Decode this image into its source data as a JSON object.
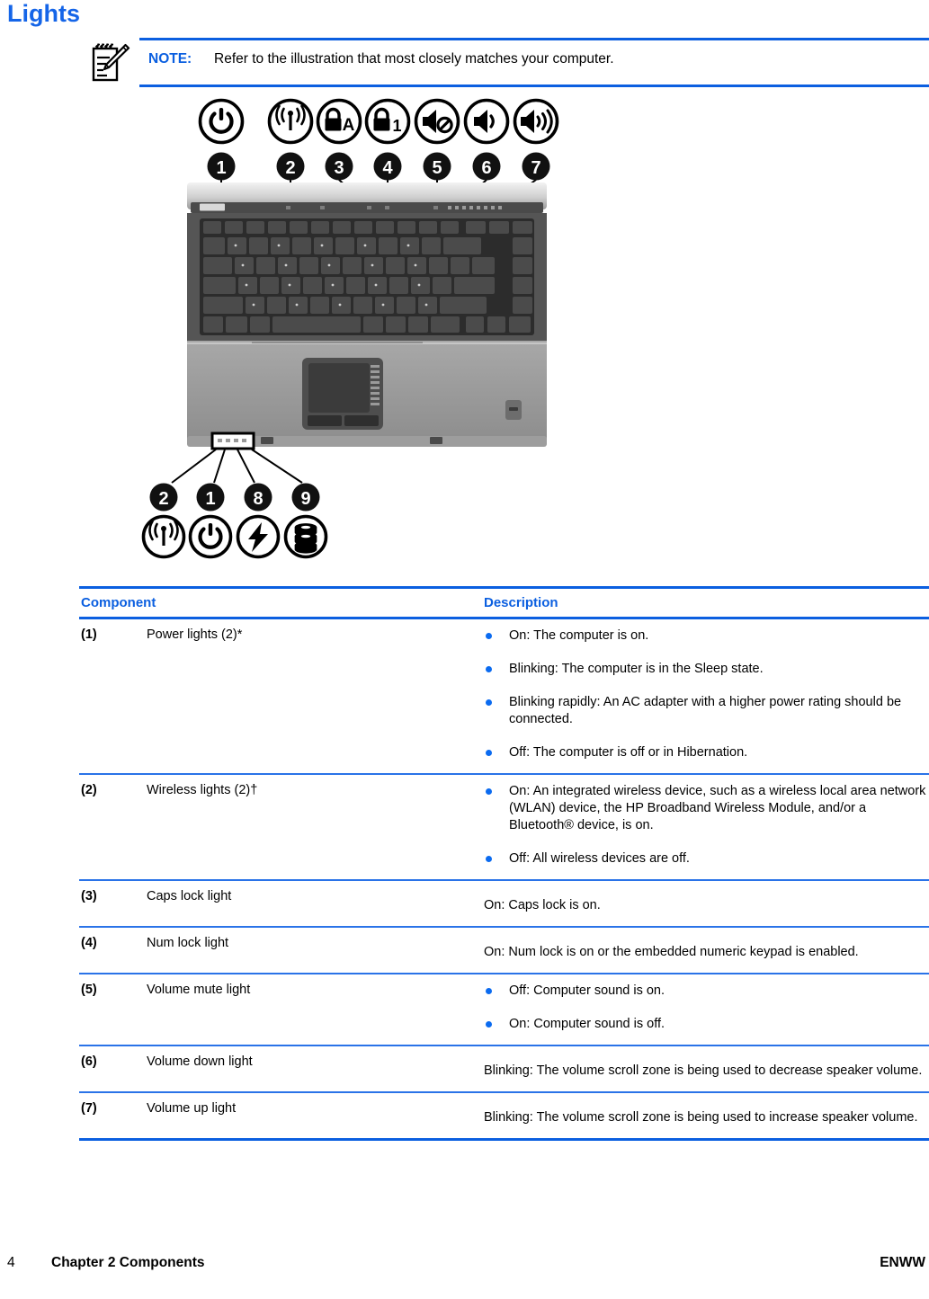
{
  "colors": {
    "accent_blue": "#0B5FE0",
    "title_blue": "#1565E8",
    "bullet_blue": "#0B6BF0"
  },
  "page": {
    "title": "Lights"
  },
  "note": {
    "icon": "note-pencil-icon",
    "label": "NOTE:",
    "text": "Refer to the illustration that most closely matches your computer."
  },
  "figure": {
    "alt": "Line drawing of an HP notebook computer showing the locations of the lights above the keyboard and on the front edge",
    "top_icons": [
      {
        "callout": "1",
        "icon": "power-icon"
      },
      {
        "callout": "2",
        "icon": "wireless-icon"
      },
      {
        "callout": "3",
        "icon": "caps-lock-icon"
      },
      {
        "callout": "4",
        "icon": "num-lock-icon"
      },
      {
        "callout": "5",
        "icon": "volume-mute-icon"
      },
      {
        "callout": "6",
        "icon": "volume-down-icon"
      },
      {
        "callout": "7",
        "icon": "volume-up-icon"
      }
    ],
    "front_icons": [
      {
        "callout": "2",
        "icon": "wireless-icon"
      },
      {
        "callout": "1",
        "icon": "power-icon"
      },
      {
        "callout": "8",
        "icon": "battery-bolt-icon"
      },
      {
        "callout": "9",
        "icon": "drive-icon"
      }
    ]
  },
  "table": {
    "headers": {
      "component": "Component",
      "description": "Description"
    },
    "rows": [
      {
        "num": "(1)",
        "name": "Power lights (2)*",
        "bullets": [
          "On: The computer is on.",
          "Blinking: The computer is in the Sleep state.",
          "Blinking rapidly: An AC adapter with a higher power rating should be connected.",
          "Off: The computer is off or in Hibernation."
        ]
      },
      {
        "num": "(2)",
        "name": "Wireless lights (2)†",
        "bullets": [
          "On: An integrated wireless device, such as a wireless local area network (WLAN) device, the HP Broadband Wireless Module, and/or a Bluetooth® device, is on.",
          "Off: All wireless devices are off."
        ]
      },
      {
        "num": "(3)",
        "name": "Caps lock light",
        "text": "On: Caps lock is on."
      },
      {
        "num": "(4)",
        "name": "Num lock light",
        "text": "On: Num lock is on or the embedded numeric keypad is enabled."
      },
      {
        "num": "(5)",
        "name": "Volume mute light",
        "bullets": [
          "Off: Computer sound is on.",
          "On: Computer sound is off."
        ]
      },
      {
        "num": "(6)",
        "name": "Volume down light",
        "text": "Blinking: The volume scroll zone is being used to decrease speaker volume."
      },
      {
        "num": "(7)",
        "name": "Volume up light",
        "text": "Blinking: The volume scroll zone is being used to increase speaker volume."
      }
    ]
  },
  "footer": {
    "page_number": "4",
    "chapter": "Chapter 2   Components",
    "right": "ENWW"
  }
}
